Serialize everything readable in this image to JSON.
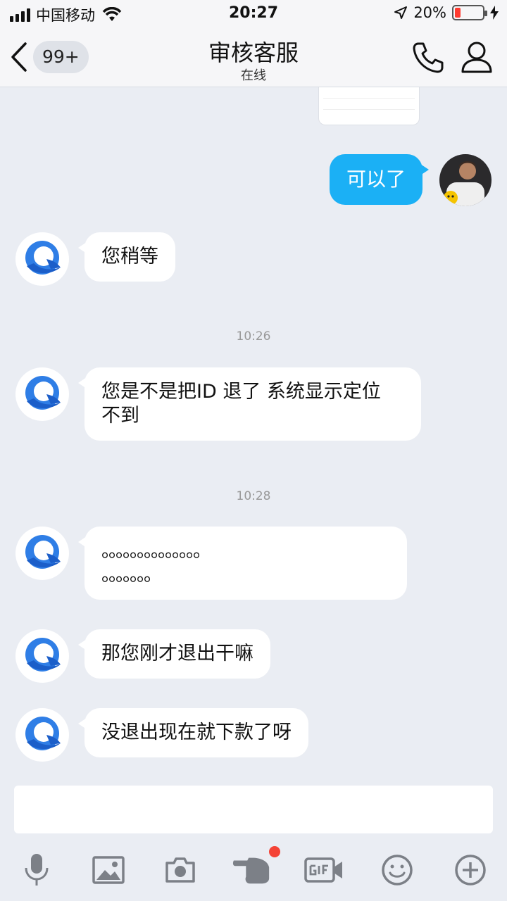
{
  "status_bar": {
    "carrier": "中国移动",
    "time": "20:27",
    "battery": "20%",
    "battery_level": 0.2
  },
  "nav": {
    "unread_badge": "99+",
    "title": "审核客服",
    "subtitle": "在线"
  },
  "messages": [
    {
      "from": "me",
      "text": "可以了"
    },
    {
      "from": "agent",
      "text": "您稍等"
    },
    {
      "type": "timestamp",
      "text": "10:26"
    },
    {
      "from": "agent",
      "line1": "您是不是把ID 退了  系统显示定位",
      "line2": "不到"
    },
    {
      "type": "timestamp",
      "text": "10:28"
    },
    {
      "from": "agent",
      "line1": "。。。。。。。。。。。。。。",
      "line2": "。。。。。。。"
    },
    {
      "from": "agent",
      "text": "那您刚才退出干嘛"
    },
    {
      "from": "agent",
      "text": "没退出现在就下款了呀"
    }
  ],
  "toolbar_icons": [
    "microphone-icon",
    "image-icon",
    "camera-icon",
    "poke-hand-icon",
    "gif-icon",
    "emoji-icon",
    "plus-icon"
  ],
  "colors": {
    "accent_bubble": "#1bb0f5",
    "background": "#eaedf3",
    "notification_dot": "#f44336",
    "battery_low": "#ff3b30"
  }
}
